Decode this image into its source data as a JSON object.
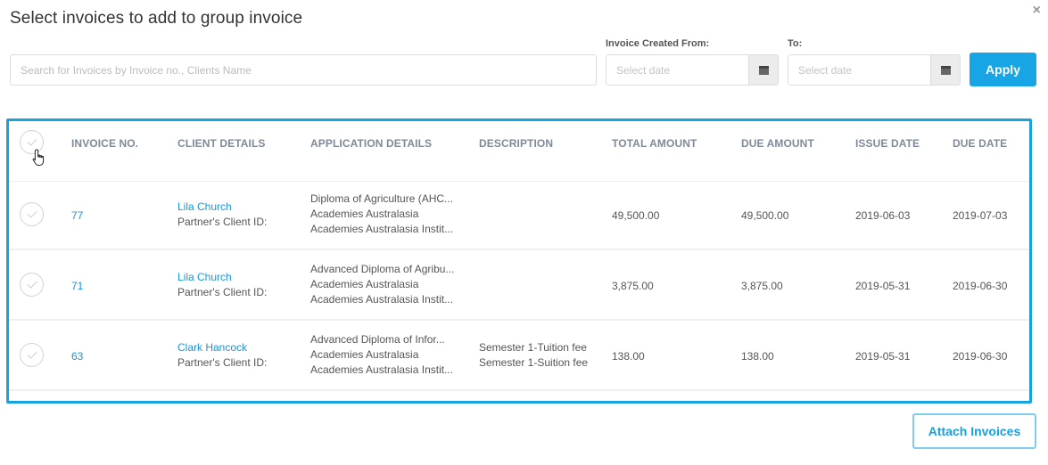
{
  "modal": {
    "title": "Select invoices to add to group invoice",
    "close_symbol": "×"
  },
  "filters": {
    "search_placeholder": "Search for Invoices by Invoice no., Clients Name",
    "created_from_label": "Invoice Created From:",
    "to_label": "To:",
    "from_placeholder": "Select date",
    "to_placeholder": "Select date",
    "apply_label": "Apply"
  },
  "table": {
    "headers": {
      "invoice_no": "INVOICE NO.",
      "client_details": "CLIENT DETAILS",
      "application_details": "APPLICATION DETAILS",
      "description": "DESCRIPTION",
      "total_amount": "TOTAL AMOUNT",
      "due_amount": "DUE AMOUNT",
      "issue_date": "ISSUE DATE",
      "due_date": "DUE DATE"
    },
    "rows": [
      {
        "invoice_no": "77",
        "client_name": "Lila Church",
        "client_sub": "Partner's Client ID:",
        "app_line1": "Diploma of Agriculture (AHC...",
        "app_line2": "Academies Australasia",
        "app_line3": "Academies Australasia Instit...",
        "desc_line1": "",
        "desc_line2": "",
        "total_amount": "49,500.00",
        "due_amount": "49,500.00",
        "issue_date": "2019-06-03",
        "due_date": "2019-07-03"
      },
      {
        "invoice_no": "71",
        "client_name": "Lila Church",
        "client_sub": "Partner's Client ID:",
        "app_line1": "Advanced Diploma of Agribu...",
        "app_line2": "Academies Australasia",
        "app_line3": "Academies Australasia Instit...",
        "desc_line1": "",
        "desc_line2": "",
        "total_amount": "3,875.00",
        "due_amount": "3,875.00",
        "issue_date": "2019-05-31",
        "due_date": "2019-06-30"
      },
      {
        "invoice_no": "63",
        "client_name": "Clark Hancock",
        "client_sub": "Partner's Client ID:",
        "app_line1": "Advanced Diploma of Infor...",
        "app_line2": "Academies Australasia",
        "app_line3": "Academies Australasia Instit...",
        "desc_line1": "Semester 1-Tuition fee",
        "desc_line2": "Semester 1-Suition fee",
        "total_amount": "138.00",
        "due_amount": "138.00",
        "issue_date": "2019-05-31",
        "due_date": "2019-06-30"
      }
    ]
  },
  "footer": {
    "attach_label": "Attach Invoices"
  },
  "colors": {
    "accent": "#17a5e6",
    "link": "#1a95d4",
    "header_text": "#7e8a99",
    "frame_highlight": "#16a3df"
  },
  "icons": [
    "close-icon",
    "calendar-icon",
    "check-circle-icon",
    "hand-pointer-icon"
  ]
}
